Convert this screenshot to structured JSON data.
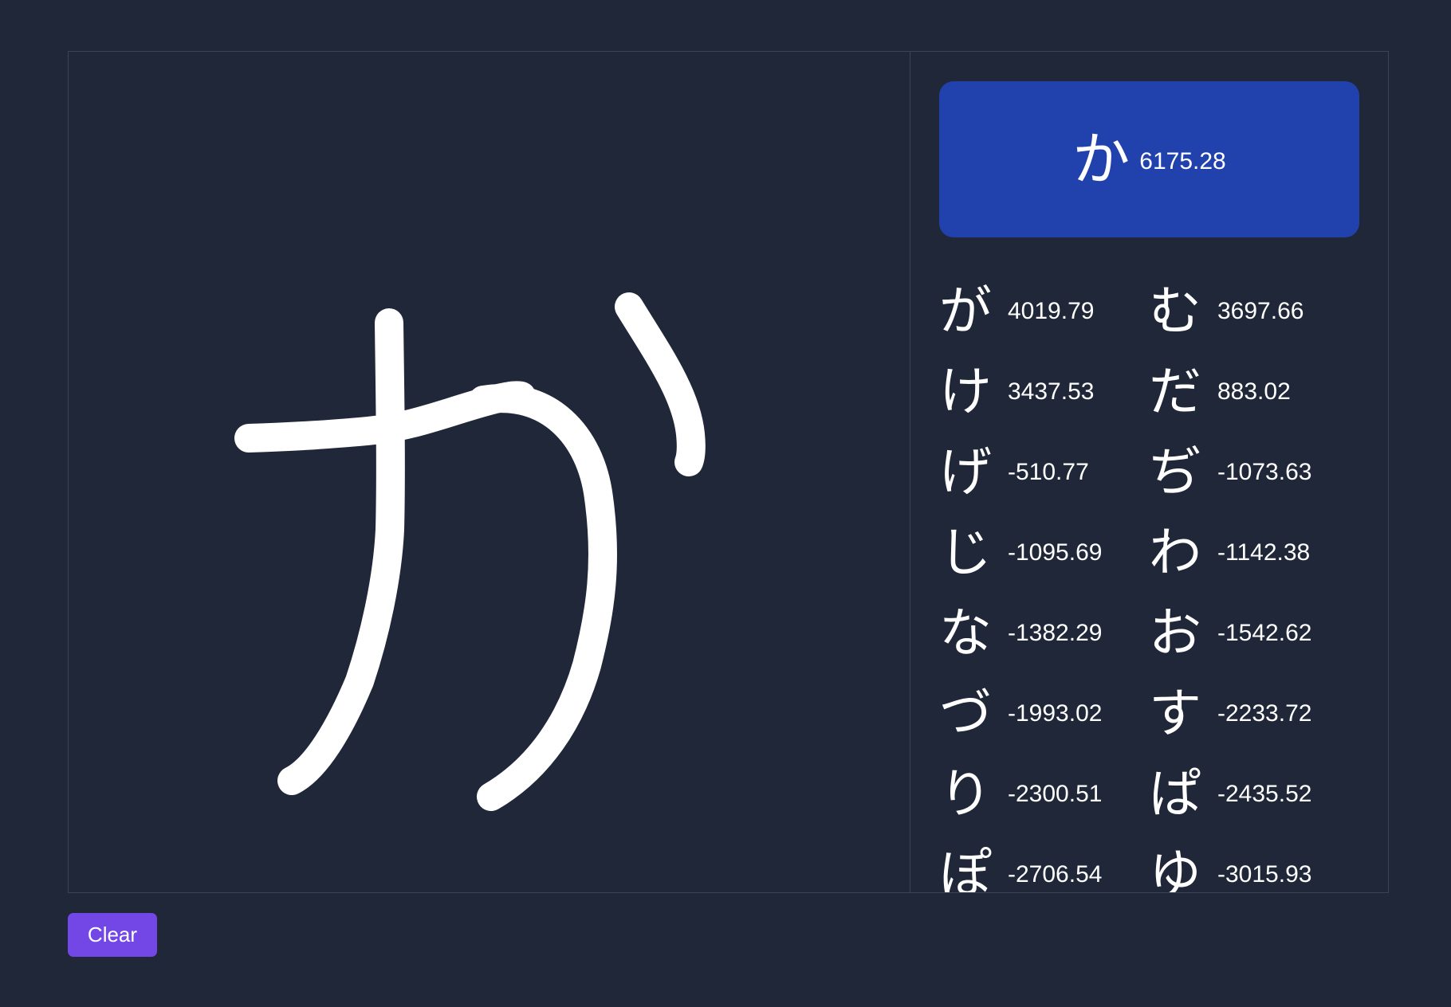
{
  "top_result": {
    "char": "か",
    "score": "6175.28"
  },
  "candidates": [
    {
      "char": "が",
      "score": "4019.79"
    },
    {
      "char": "む",
      "score": "3697.66"
    },
    {
      "char": "け",
      "score": "3437.53"
    },
    {
      "char": "だ",
      "score": "883.02"
    },
    {
      "char": "げ",
      "score": "-510.77"
    },
    {
      "char": "ぢ",
      "score": "-1073.63"
    },
    {
      "char": "じ",
      "score": "-1095.69"
    },
    {
      "char": "わ",
      "score": "-1142.38"
    },
    {
      "char": "な",
      "score": "-1382.29"
    },
    {
      "char": "お",
      "score": "-1542.62"
    },
    {
      "char": "づ",
      "score": "-1993.02"
    },
    {
      "char": "す",
      "score": "-2233.72"
    },
    {
      "char": "り",
      "score": "-2300.51"
    },
    {
      "char": "ぱ",
      "score": "-2435.52"
    },
    {
      "char": "ぽ",
      "score": "-2706.54"
    },
    {
      "char": "ゆ",
      "score": "-3015.93"
    }
  ],
  "buttons": {
    "clear_label": "Clear"
  },
  "colors": {
    "background": "#1f2738",
    "top_result_bg": "#2142ac",
    "clear_button_bg": "#7347e6",
    "stroke": "#ffffff"
  }
}
